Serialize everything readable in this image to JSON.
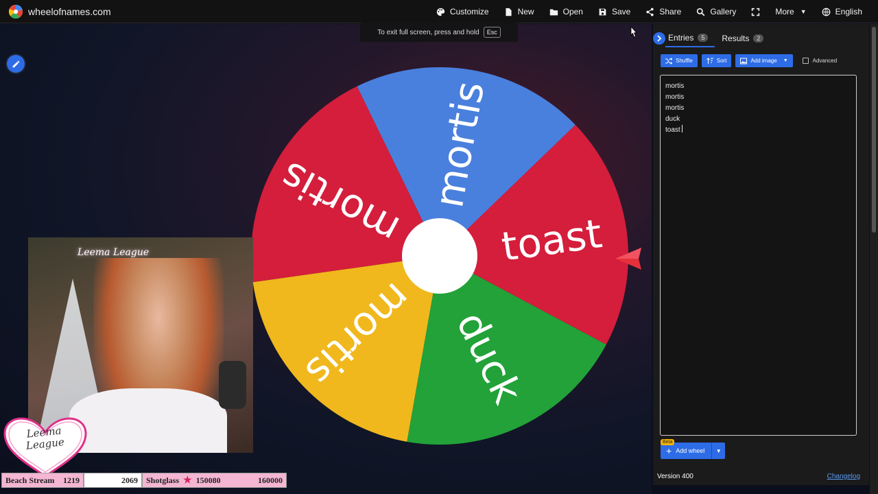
{
  "header": {
    "site_name": "wheelofnames.com",
    "nav": [
      {
        "label": "Customize",
        "icon": "palette-icon"
      },
      {
        "label": "New",
        "icon": "file-icon"
      },
      {
        "label": "Open",
        "icon": "folder-icon"
      },
      {
        "label": "Save",
        "icon": "save-icon"
      },
      {
        "label": "Share",
        "icon": "share-icon"
      },
      {
        "label": "Gallery",
        "icon": "search-icon"
      },
      {
        "label": "",
        "icon": "fullscreen-icon"
      },
      {
        "label": "More",
        "icon": "chevron-down-icon"
      },
      {
        "label": "English",
        "icon": "globe-icon"
      }
    ]
  },
  "fullscreen_toast": {
    "message": "To exit full screen, press and hold",
    "key": "Esc"
  },
  "wheel": {
    "segments": [
      {
        "label": "mortis",
        "color": "#4a80dd"
      },
      {
        "label": "toast",
        "color": "#d41e3c"
      },
      {
        "label": "duck",
        "color": "#22a238"
      },
      {
        "label": "mortis",
        "color": "#f0b81c"
      },
      {
        "label": "mortis",
        "color": "#d41e3c"
      }
    ],
    "pointer_color": "#e8303c"
  },
  "overlay": {
    "neon_sign": "Leema League",
    "badge_text_line1": "Leema",
    "badge_text_line2": "League",
    "stats": {
      "beach_label": "Beach Stream",
      "beach_value": "1219",
      "beach_total": "2069",
      "shot_label": "Shotglass",
      "shot_value": "150080",
      "shot_goal": "160000"
    }
  },
  "sidebar": {
    "tabs": [
      {
        "label": "Entries",
        "count": "5"
      },
      {
        "label": "Results",
        "count": "2"
      }
    ],
    "toolbar": {
      "shuffle": "Shuffle",
      "sort": "Sort",
      "add_image": "Add image",
      "advanced": "Advanced"
    },
    "entries": [
      "mortis",
      "mortis",
      "mortis",
      "duck",
      "toast"
    ],
    "add_wheel": "Add wheel",
    "beta": "Beta",
    "version": "Version 400",
    "changelog": "Changelog"
  },
  "colors": {
    "accent": "#2d6ce6",
    "topbar": "#121212",
    "sidebar": "#1b1b1b"
  }
}
